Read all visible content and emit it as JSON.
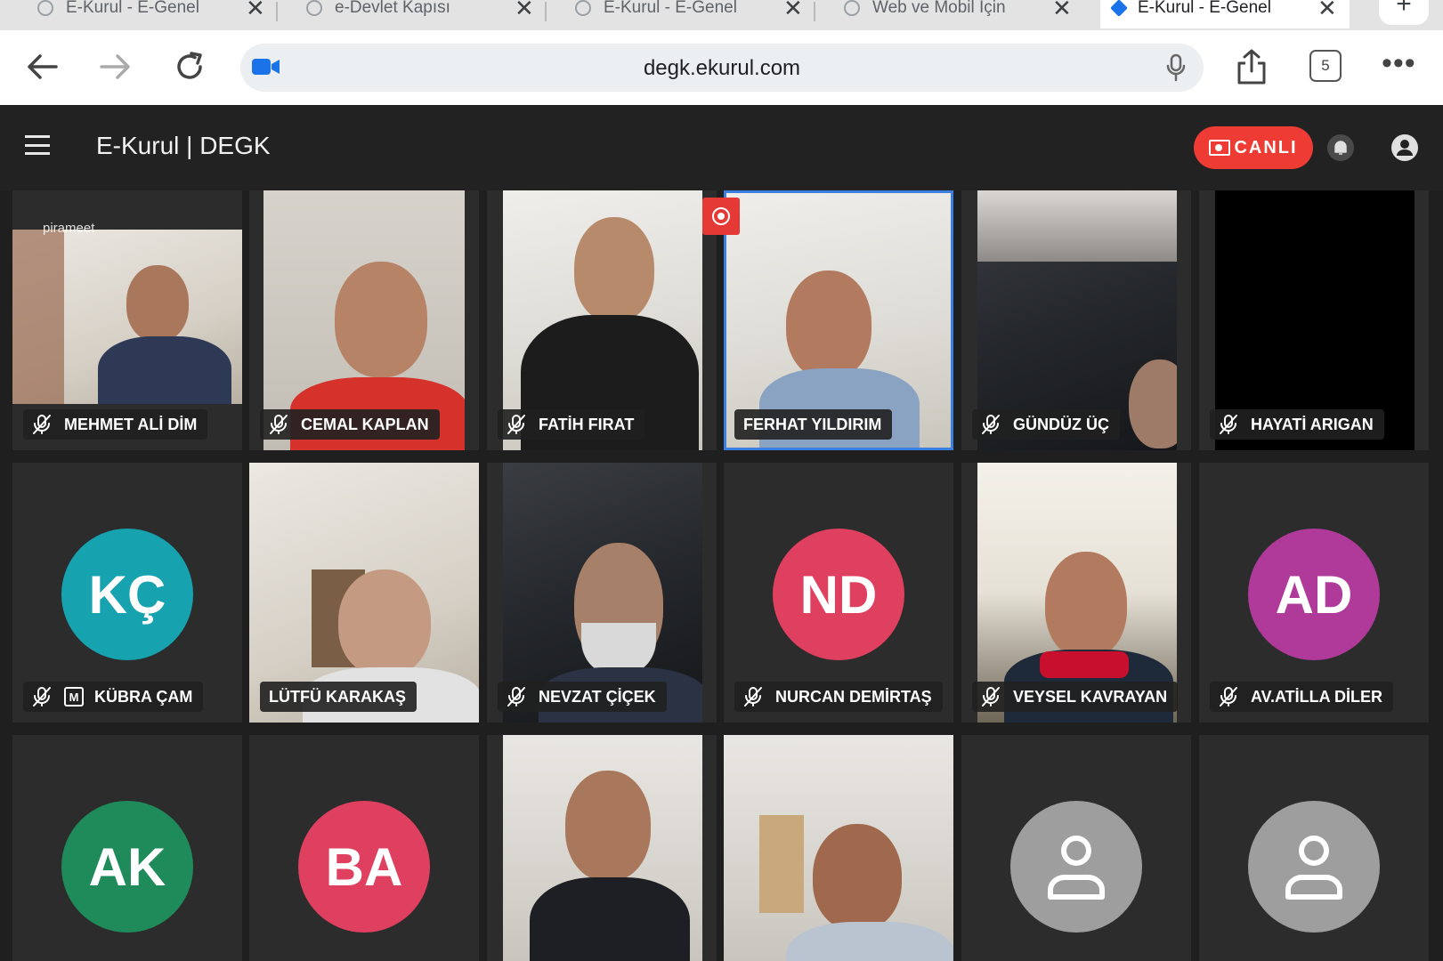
{
  "browser": {
    "tabs": [
      {
        "title": "E-Kurul - E-Genel",
        "active": false
      },
      {
        "title": "e-Devlet Kapısı",
        "active": false
      },
      {
        "title": "E-Kurul - E-Genel",
        "active": false
      },
      {
        "title": "Web ve Mobil İçin",
        "active": false
      },
      {
        "title": "E-Kurul - E-Genel",
        "active": true
      }
    ],
    "new_tab": "+",
    "url": "degk.ekurul.com",
    "tab_count": "5",
    "more": "•••"
  },
  "app": {
    "title": "E-Kurul | DEGK",
    "live_label": "CANLI",
    "live_color": "#ee3b34"
  },
  "participants": [
    {
      "name": "MEHMET ALİ DİM",
      "muted": true,
      "video": "wall1",
      "watermark": "pirameet"
    },
    {
      "name": "CEMAL KAPLAN",
      "muted": true,
      "video": "wall3"
    },
    {
      "name": "FATİH FIRAT",
      "muted": true,
      "video": "wall2"
    },
    {
      "name": "FERHAT YILDIRIM",
      "muted": false,
      "video": "wall2",
      "speaking": true
    },
    {
      "name": "GÜNDÜZ ÜÇ",
      "muted": true,
      "video": "car"
    },
    {
      "name": "HAYATİ ARIGAN",
      "muted": true,
      "video": "black"
    },
    {
      "name": "KÜBRA ÇAM",
      "muted": true,
      "moderator_badge": "M",
      "initials": "KÇ",
      "avatar_color": "#17a2b0"
    },
    {
      "name": "LÜTFÜ KARAKAŞ",
      "muted": false,
      "video": "wall1"
    },
    {
      "name": "NEVZAT ÇİÇEK",
      "muted": true,
      "video": "car"
    },
    {
      "name": "NURCAN DEMİRTAŞ",
      "muted": true,
      "initials": "ND",
      "avatar_color": "#e0405f"
    },
    {
      "name": "VEYSEL KAVRAYAN",
      "muted": true,
      "video": "window"
    },
    {
      "name": "AV.ATİLLA DİLER",
      "muted": true,
      "initials": "AD",
      "avatar_color": "#b03a9a"
    },
    {
      "initials": "AK",
      "avatar_color": "#1f8b5a"
    },
    {
      "initials": "BA",
      "avatar_color": "#e0405f"
    },
    {
      "video": "room"
    },
    {
      "video": "room"
    },
    {
      "avatar_color": "#9e9e9e"
    },
    {
      "avatar_color": "#9e9e9e"
    }
  ]
}
